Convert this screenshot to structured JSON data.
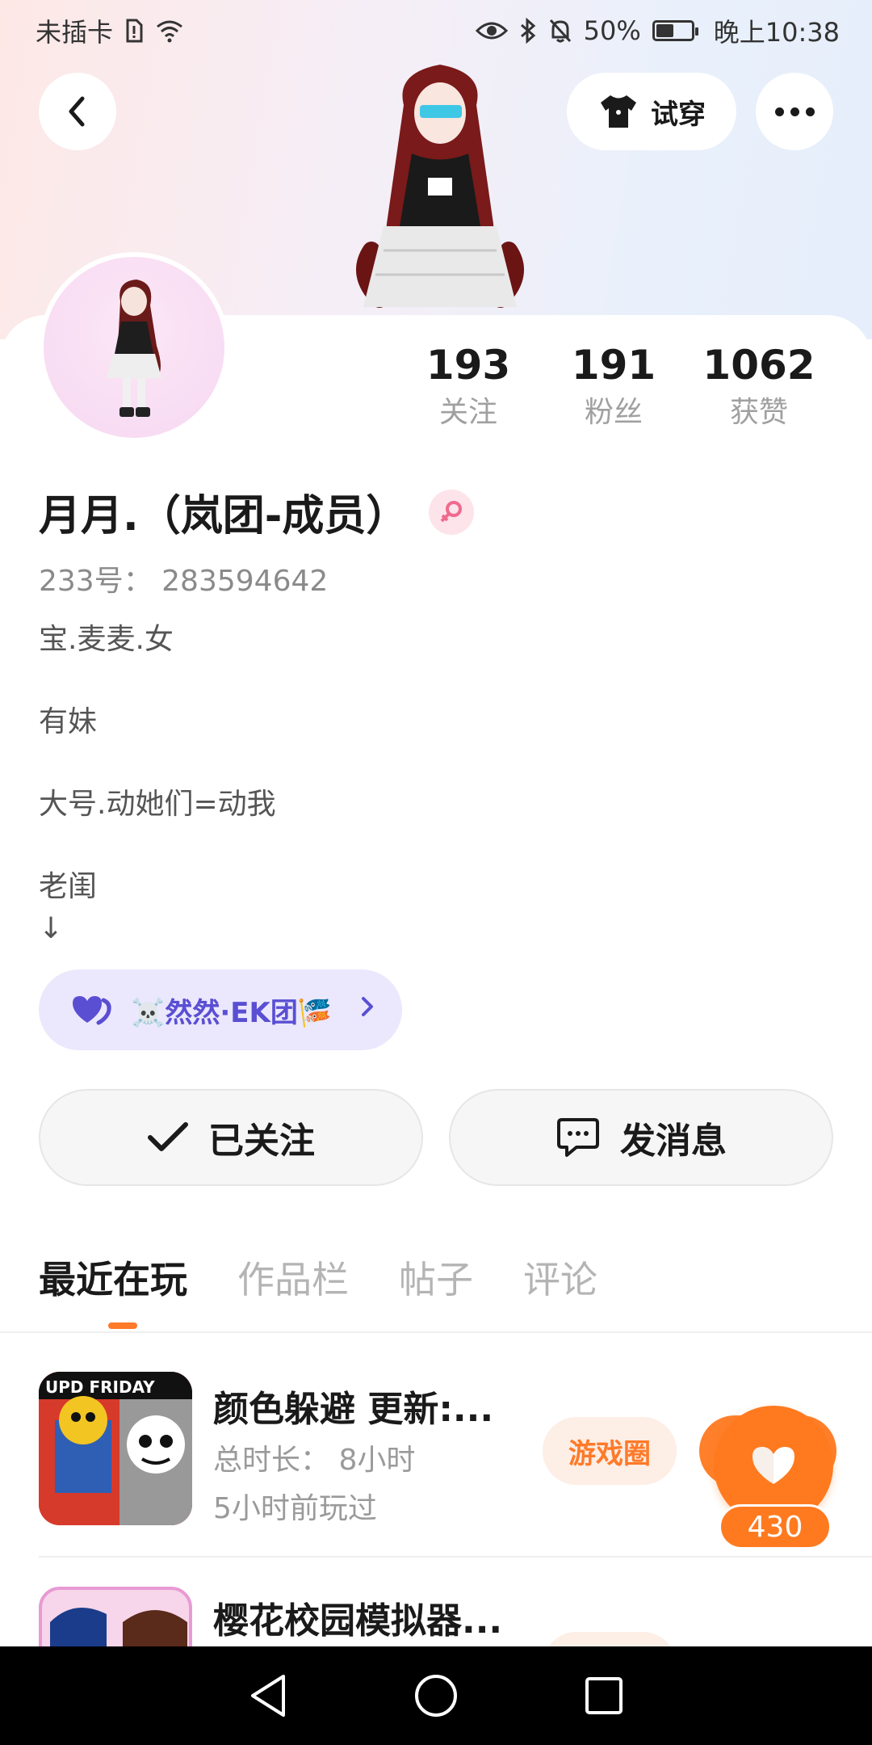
{
  "status_bar": {
    "carrier": "未插卡",
    "battery": "50%",
    "battery_level": 0.5,
    "time": "晚上10:38"
  },
  "header": {
    "tryon_label": "试穿"
  },
  "profile": {
    "stats": [
      {
        "value": "193",
        "label": "关注"
      },
      {
        "value": "191",
        "label": "粉丝"
      },
      {
        "value": "1062",
        "label": "获赞"
      }
    ],
    "name": "月月.（岚团-成员）",
    "uid": "233号：  283594642",
    "bio": [
      "宝.麦麦.女",
      "有妹",
      "大号.动她们=动我",
      "老闺",
      "↓"
    ],
    "group": "☠️然然·EK团🎏"
  },
  "actions": {
    "follow_label": "已关注",
    "message_label": "发消息"
  },
  "tabs": [
    "最近在玩",
    "作品栏",
    "帖子",
    "评论"
  ],
  "games": [
    {
      "title": "颜色躲避 更新:...",
      "playtime": "总时长：  8小时",
      "last_played": "5小时前玩过",
      "circle_label": "游戏圈",
      "thumb_text": "UPD FRIDAY"
    },
    {
      "title": "樱花校园模拟器..."
    }
  ],
  "like": {
    "count": "430"
  },
  "colors": {
    "accent": "#ff7a29",
    "group_text": "#5a4fd3",
    "group_bg": "#ebe8fd"
  }
}
